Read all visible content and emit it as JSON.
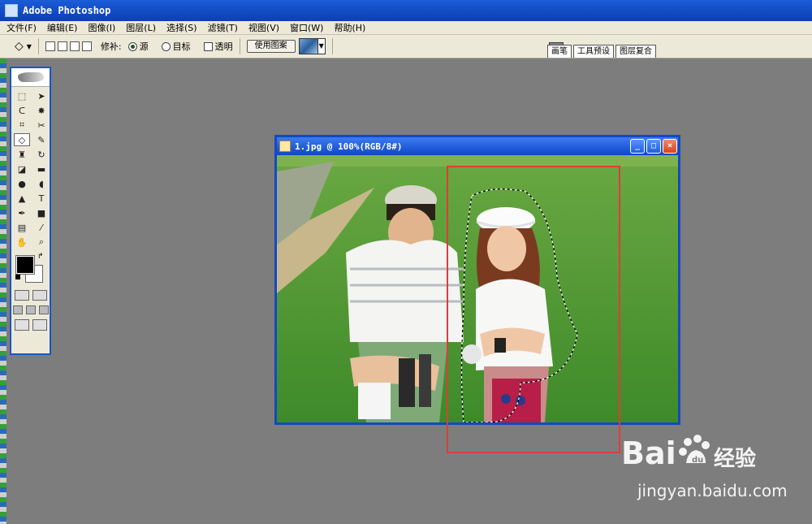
{
  "app": {
    "title": "Adobe Photoshop"
  },
  "menu": [
    "文件(F)",
    "编辑(E)",
    "图像(I)",
    "图层(L)",
    "选择(S)",
    "滤镜(T)",
    "视图(V)",
    "窗口(W)",
    "帮助(H)"
  ],
  "options": {
    "patch_label": "修补:",
    "source_label": "源",
    "target_label": "目标",
    "transparent_label": "透明",
    "use_pattern_label": "使用图案",
    "patch_mode_selected": "source"
  },
  "palette_well": {
    "tabs": [
      "画笔",
      "工具预设",
      "图层复合"
    ]
  },
  "toolbox": {
    "tools": [
      {
        "name": "marquee-icon",
        "glyph": "⬚"
      },
      {
        "name": "move-icon",
        "glyph": "➤"
      },
      {
        "name": "lasso-icon",
        "glyph": "ᑕ"
      },
      {
        "name": "magic-wand-icon",
        "glyph": "✸"
      },
      {
        "name": "crop-icon",
        "glyph": "⌗"
      },
      {
        "name": "slice-icon",
        "glyph": "✂"
      },
      {
        "name": "patch-icon",
        "glyph": "◇",
        "active": true
      },
      {
        "name": "brush-icon",
        "glyph": "✎"
      },
      {
        "name": "clone-stamp-icon",
        "glyph": "♜"
      },
      {
        "name": "history-brush-icon",
        "glyph": "↻"
      },
      {
        "name": "eraser-icon",
        "glyph": "◪"
      },
      {
        "name": "gradient-icon",
        "glyph": "▬"
      },
      {
        "name": "blur-icon",
        "glyph": "●"
      },
      {
        "name": "dodge-icon",
        "glyph": "◖"
      },
      {
        "name": "path-select-icon",
        "glyph": "▲"
      },
      {
        "name": "type-icon",
        "glyph": "T"
      },
      {
        "name": "pen-icon",
        "glyph": "✒"
      },
      {
        "name": "shape-icon",
        "glyph": "■"
      },
      {
        "name": "notes-icon",
        "glyph": "▤"
      },
      {
        "name": "eyedropper-icon",
        "glyph": "⁄"
      },
      {
        "name": "hand-icon",
        "glyph": "✋"
      },
      {
        "name": "zoom-icon",
        "glyph": "⌕"
      }
    ],
    "foreground_color": "#000000",
    "background_color": "#ffffff"
  },
  "document": {
    "title": "1.jpg @ 100%(RGB/8#)",
    "window_buttons": [
      "_",
      "□",
      "×"
    ]
  },
  "annotation": {
    "highlight_color": "#e23a3a"
  },
  "watermark": {
    "brand": "Bai",
    "brand_cn": "经验",
    "url": "jingyan.baidu.com"
  }
}
